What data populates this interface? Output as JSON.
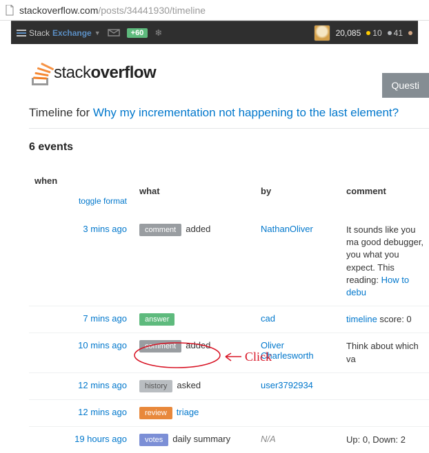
{
  "url": {
    "host": "stackoverflow.com",
    "path": "/posts/34441930/timeline"
  },
  "topbar": {
    "stack_text": "Stack",
    "exchange_text": "Exchange",
    "rep_delta": "+60",
    "user_rep": "20,085",
    "gold_count": "10",
    "silver_count": "41"
  },
  "logo": {
    "stack": "stack",
    "overflow": "overflow"
  },
  "quest_button": "Questi",
  "timeline_title_prefix": "Timeline for ",
  "timeline_question_link": "Why my incrementation not happening to the last element?",
  "events_count_label": "6 events",
  "columns": {
    "when": "when",
    "toggle": "toggle format",
    "what": "what",
    "by": "by",
    "comment": "comment"
  },
  "rows": [
    {
      "when": "3 mins ago",
      "tag": "comment",
      "tag_class": "tag-comment",
      "action": "added",
      "action_link": false,
      "by": "NathanOliver",
      "comment_html": "It sounds like you ma good debugger, you what you expect. This reading: ",
      "comment_link": "How to debu"
    },
    {
      "when": "7 mins ago",
      "tag": "answer",
      "tag_class": "tag-answer",
      "action": "",
      "by": "cad",
      "comment_html": "",
      "comment_prefix_link": "timeline",
      "comment_suffix": "   score: 0"
    },
    {
      "when": "10 mins ago",
      "tag": "comment",
      "tag_class": "tag-comment",
      "action": "added",
      "action_link": false,
      "by": "Oliver Charlesworth",
      "comment_html": "Think about which va"
    },
    {
      "when": "12 mins ago",
      "tag": "history",
      "tag_class": "tag-history",
      "action": "asked",
      "action_link": false,
      "by": "user3792934",
      "comment_html": ""
    },
    {
      "when": "12 mins ago",
      "tag": "review",
      "tag_class": "tag-review",
      "action": "triage",
      "action_link": true,
      "by": "",
      "comment_html": ""
    },
    {
      "when": "19 hours ago",
      "tag": "votes",
      "tag_class": "tag-votes",
      "action": "daily summary",
      "action_link": false,
      "by": "N/A",
      "by_na": true,
      "comment_html": "Up: 0, Down: 2"
    }
  ],
  "annotation_text": "Click"
}
